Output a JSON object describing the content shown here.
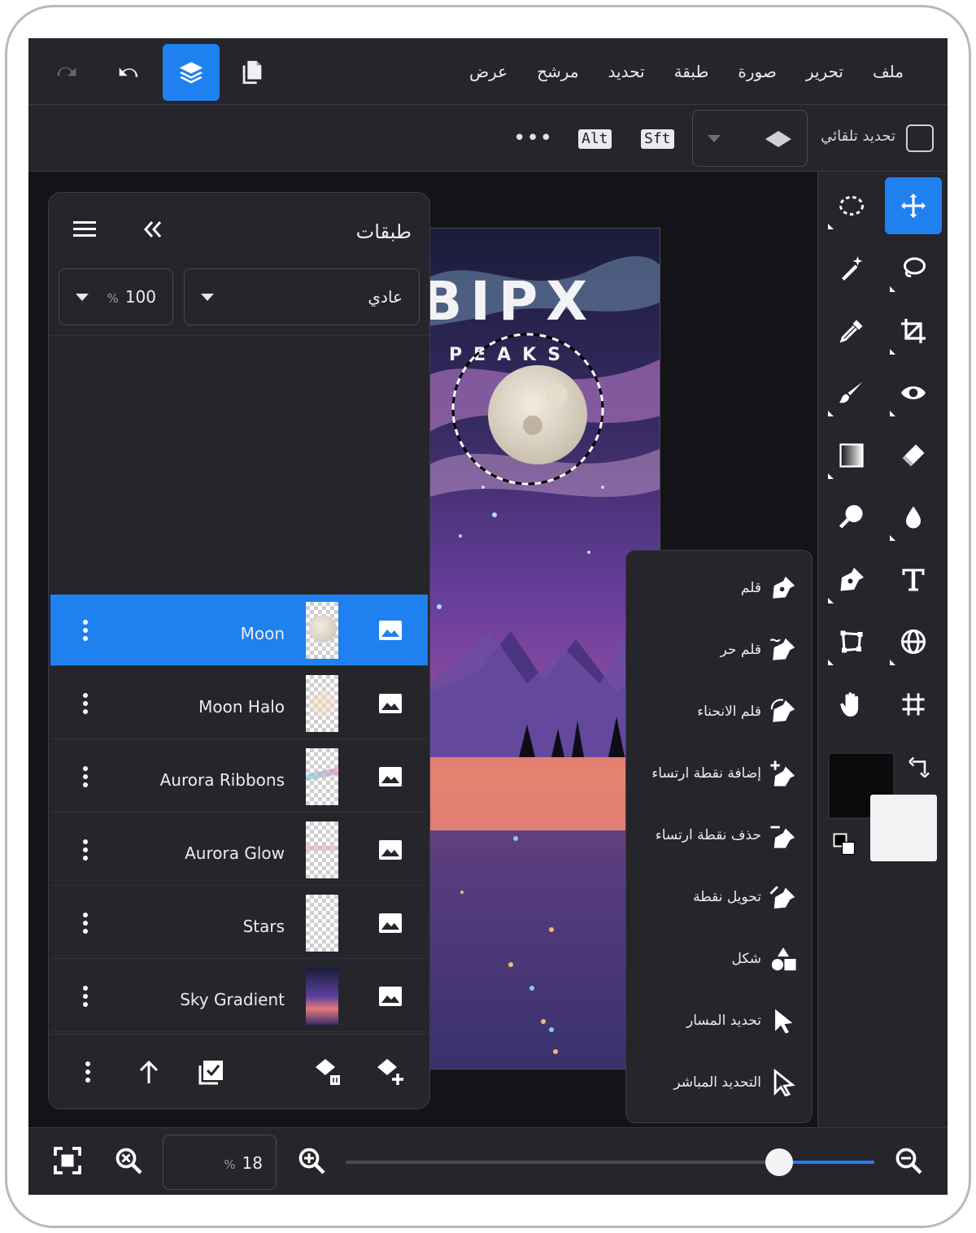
{
  "menu": {
    "items": [
      "ملف",
      "تحرير",
      "صورة",
      "طبقة",
      "تحديد",
      "مرشح",
      "عرض"
    ]
  },
  "toolbar": {
    "redo": "redo-icon",
    "undo": "undo-icon",
    "layers": "layers-icon",
    "pages": "pages-icon"
  },
  "options": {
    "auto_select_label": "تحديد تلقائي",
    "alt_key": "Alt",
    "shift_key": "Sft",
    "more": "•••"
  },
  "layers_panel": {
    "title": "طبقات",
    "blend_mode": "عادي",
    "opacity_value": "100",
    "opacity_unit": "%",
    "layers": [
      {
        "name": "Moon",
        "selected": true
      },
      {
        "name": "Moon Halo",
        "selected": false
      },
      {
        "name": "Aurora Ribbons",
        "selected": false
      },
      {
        "name": "Aurora Glow",
        "selected": false
      },
      {
        "name": "Stars",
        "selected": false
      },
      {
        "name": "Sky Gradient",
        "selected": false
      }
    ]
  },
  "artwork": {
    "title_partial": "BIPX",
    "subtitle_partial": "PEAKS"
  },
  "pen_menu": {
    "items": [
      "قلم",
      "قلم حر",
      "قلم الانحناء",
      "إضافة نقطة ارتساء",
      "حذف نقطة ارتساء",
      "تحويل نقطة",
      "شكل",
      "تحديد المسار",
      "التحديد المباشر"
    ]
  },
  "zoom": {
    "value": "18",
    "unit": "%",
    "slider_fraction": 0.82
  },
  "colors": {
    "accent": "#1f80f0",
    "foreground": "#0b0b0e",
    "background": "#f2f2f4",
    "panel": "#25252b"
  }
}
